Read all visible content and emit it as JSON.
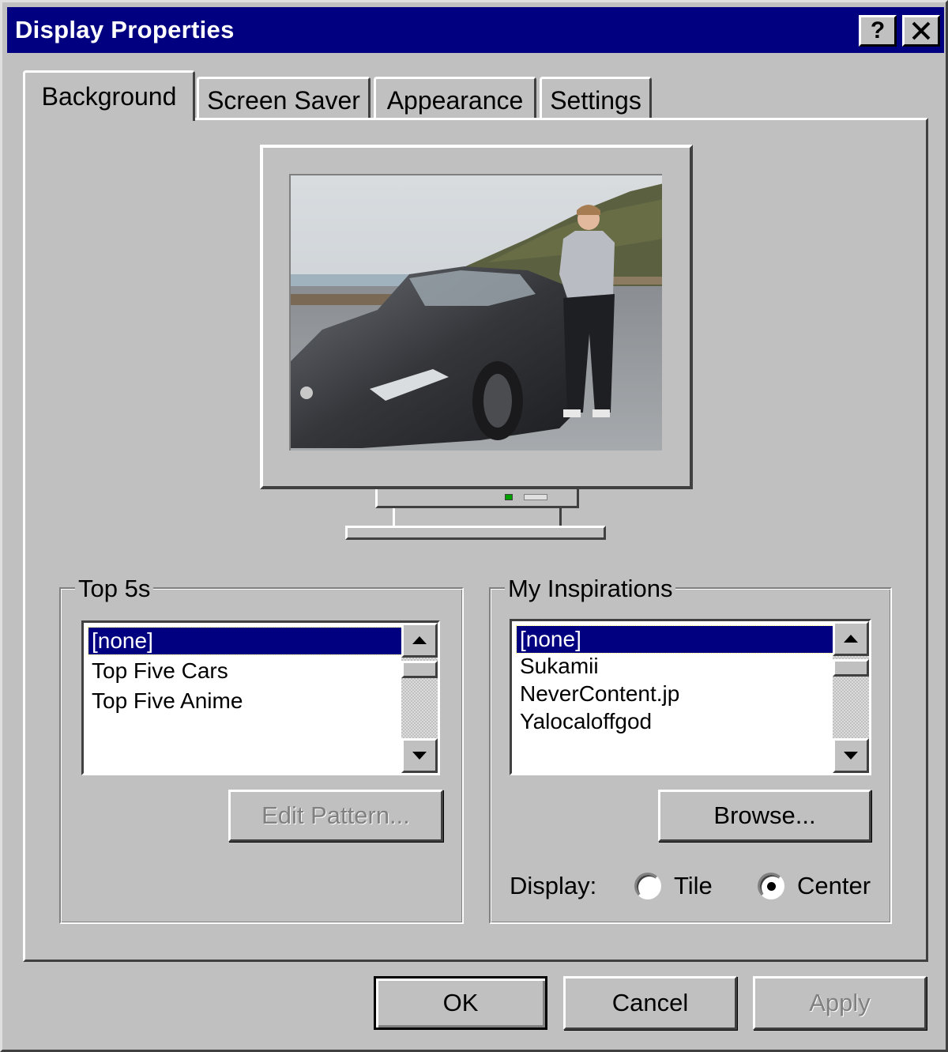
{
  "window": {
    "title": "Display Properties",
    "help_button": "?",
    "close_button": "✕"
  },
  "tabs": [
    {
      "label": "Background",
      "active": true
    },
    {
      "label": "Screen Saver",
      "active": false
    },
    {
      "label": "Appearance",
      "active": false
    },
    {
      "label": "Settings",
      "active": false
    }
  ],
  "preview": {
    "image_description": "photo of a person standing next to a dark sports car by the coast"
  },
  "top5s": {
    "label": "Top 5s",
    "items": [
      "[none]",
      "Top Five Cars",
      "Top Five Anime"
    ],
    "selected_index": 0,
    "edit_button": "Edit Pattern..."
  },
  "inspirations": {
    "label": "My Inspirations",
    "items": [
      "[none]",
      "Sukamii",
      "NeverContent.jp",
      "Yalocaloffgod"
    ],
    "selected_index": 0,
    "browse_button": "Browse...",
    "display_label": "Display:",
    "options": [
      {
        "label": "Tile",
        "selected": false
      },
      {
        "label": "Center",
        "selected": true
      }
    ]
  },
  "footer": {
    "ok": "OK",
    "cancel": "Cancel",
    "apply": "Apply"
  },
  "colors": {
    "titlebar": "#000080",
    "face": "#c0c0c0",
    "selection": "#000080"
  }
}
